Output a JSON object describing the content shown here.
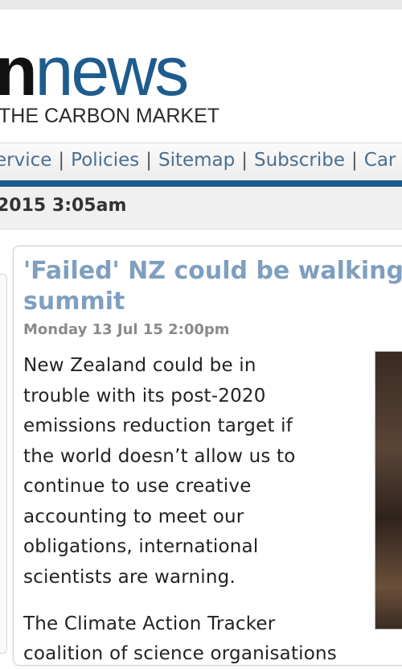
{
  "header": {
    "logo_part_black": "n",
    "logo_part_blue": "news",
    "tagline": "THE CARBON MARKET"
  },
  "nav": {
    "items": [
      "ervice",
      "Policies",
      "Sitemap",
      "Subscribe",
      "Car"
    ],
    "separator": "|"
  },
  "datebar": {
    "datetime": "2015 3:05am"
  },
  "article": {
    "headline_line1": "'Failed' NZ could be walking",
    "headline_line2": "summit",
    "byline": "Monday 13 Jul 15 2:00pm",
    "paragraph1_lines": [
      "New Zealand could be in",
      "trouble with its post-2020",
      "emissions reduction target if",
      "the world doesn’t allow us to",
      "continue to use creative",
      "accounting to meet our",
      "obligations, international",
      "scientists are warning."
    ],
    "paragraph2_lines": [
      "The Climate Action Tracker",
      "coalition of science organisations"
    ]
  },
  "colors": {
    "brand_blue": "#1f5c8e",
    "headline": "#7e9fbf",
    "nav_link": "#4a6f8f"
  }
}
